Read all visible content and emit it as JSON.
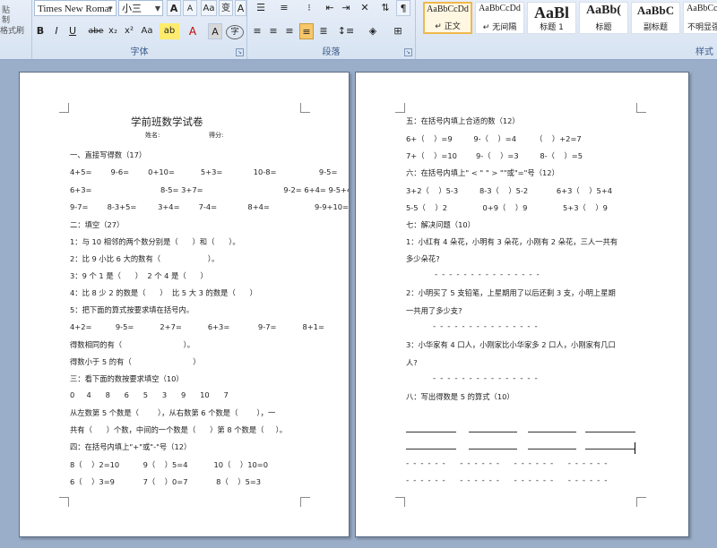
{
  "ribbon": {
    "clipboard_partial": [
      "贴",
      "制",
      "格式刷"
    ],
    "font_group": {
      "label": "字体",
      "font_name": "Times New Romar",
      "font_size": "小三",
      "buttons": [
        "A",
        "A",
        "Aa",
        "变",
        "A"
      ],
      "format_buttons": [
        "B",
        "I",
        "U",
        "abe",
        "x₂",
        "x²",
        "Aa",
        "ab",
        "A",
        "A",
        "字"
      ]
    },
    "paragraph_group": {
      "label": "段落"
    },
    "styles_group": {
      "label": "样式",
      "styles": [
        {
          "sample": "AaBbCcDd",
          "name": "↵ 正文",
          "selected": true
        },
        {
          "sample": "AaBbCcDd",
          "name": "↵ 无间隔",
          "selected": false
        },
        {
          "sample": "AaBl",
          "name": "标题 1",
          "selected": false
        },
        {
          "sample": "AaBb(",
          "name": "标题",
          "selected": false
        },
        {
          "sample": "AaBbC",
          "name": "副标题",
          "selected": false
        },
        {
          "sample": "AaBbCcDd",
          "name": "不明显强调",
          "selected": false
        }
      ]
    }
  },
  "page1": {
    "title": "学前班数学试卷",
    "name_label": "姓名:",
    "score_label": "得分:",
    "lines": [
      "一、直接写得数（17）",
      "4+5=        9-6=        0+10=           5+3=             10-8=                  9-5=",
      "6+3=                             8-5= 3+7=                                  9-2= 6+4= 9-5+4=",
      "9-7=        8-3+5=         3+4=        7-4=             8+4=                   9-9+10=",
      "二：填空（27）",
      "1：与 10 相邻的两个数分别是（      ）和（      ）。",
      "2：比 9 小比 6 大的数有（                    ）。",
      "3：9 个 1 是（      ）  2 个 4 是（      ）",
      "4：比 8 少 2 的数是（      ）  比 5 大 3 的数是（      ）",
      "5：把下面的算式按要求填在括号内。",
      "4+2=          9-5=           2+7=           6+3=            9-7=           8+1=",
      "得数相同的有（                          ）。",
      "得数小于 5 的有（                          ）",
      "三：看下面的数按要求填空（10）",
      "0     4      8      6      5      3      9      10      7",
      "从左数第 5 个数是（        ），从右数第 6 个数是（        ），一",
      "共有（      ）个数，中间的一个数是（      ）第 8 个数是（     ）。",
      "四：在括号内填上\"+\"或\"-\"号（12）",
      "8（    ）2=10          9（    ）5=4           10（    ）10=0",
      "6（    ）3=9            7（    ）0=7            8（    ）5=3"
    ]
  },
  "page2": {
    "lines": [
      "五：在括号内填上合适的数（12）",
      "6+（    ）=9         9-（    ）=4        （    ）+2=7",
      "7+（    ）=10        9-（    ）=3         8-（    ）=5",
      "六：在括号内填上\" < \" \" > \"\"或\"=\"号（12）",
      "3+2（    ）5-3         8-3（    ）5-2            6+3（    ）5+4",
      "5-5（    ）2               0+9（    ）9               5+3（    ）9",
      "七：解决问题（10）",
      "1：小红有 4 朵花，小明有 3 朵花，小刚有 2 朵花，三人一共有",
      "多少朵花?",
      "2：小明买了 5 支铅笔，上星期用了以后还剩 3 支，小明上星期",
      "一共用了多少支?",
      "3：小华家有 4 口人，小刚家比小华家多 2 口人，小刚家有几口",
      "人?",
      "八：写出得数是 5 的算式（10）"
    ],
    "dash_answer": "- - - - - - - - - - - - - - -",
    "dash_rows": [
      "- - - - - -    - - - - - -    - - - - - -    - - - - - -",
      "- - - - - -    - - - - - -    - - - - - -    - - - - - -"
    ]
  }
}
